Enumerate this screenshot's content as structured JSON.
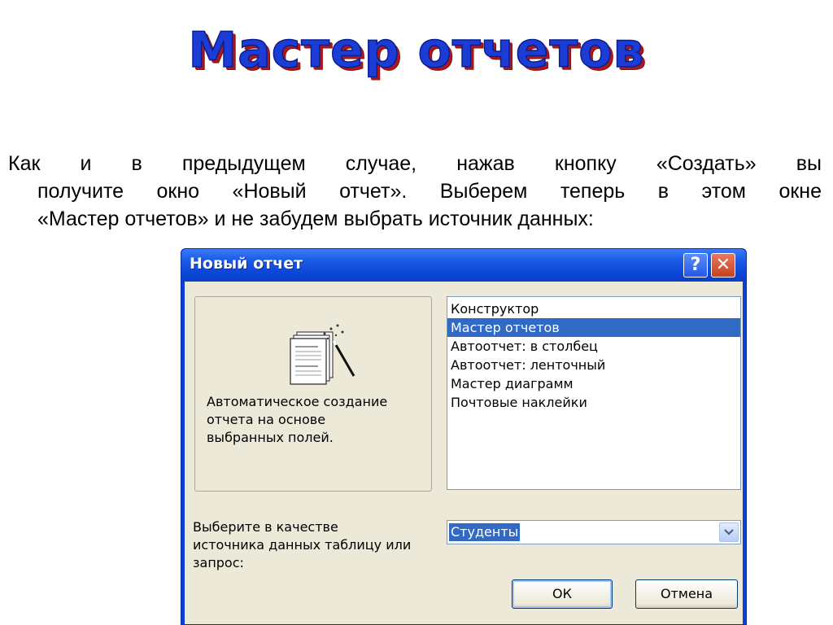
{
  "slide": {
    "title": "Мастер отчетов",
    "paragraph": {
      "line1": "Как и в предыдущем случае, нажав кнопку «Создать» вы",
      "line2": "получите окно «Новый отчет». Выберем теперь в этом окне",
      "line3": "«Мастер отчетов» и не забудем выбрать источник данных:"
    }
  },
  "dialog": {
    "title": "Новый отчет",
    "help_icon": "question-mark",
    "close_icon": "x-mark",
    "preview": {
      "icon": "report-wizard-icon",
      "description_lines": [
        "Автоматическое создание",
        "отчета на основе",
        "выбранных полей."
      ]
    },
    "list": {
      "items": [
        "Конструктор",
        "Мастер отчетов",
        "Автоотчет: в столбец",
        "Автоотчет: ленточный",
        "Мастер диаграмм",
        "Почтовые наклейки"
      ],
      "selected": "Мастер отчетов"
    },
    "source_label_lines": [
      "Выберите в качестве",
      "источника данных таблицу или",
      "запрос:"
    ],
    "source_value": "Студенты",
    "ok_label": "ОК",
    "cancel_label": "Отмена"
  },
  "colors": {
    "title_fill": "#1b3dd6",
    "title_shadow": "#b01818",
    "titlebar": "#0c48d8",
    "selection": "#316ac5",
    "dialog_bg": "#ece9d8"
  }
}
